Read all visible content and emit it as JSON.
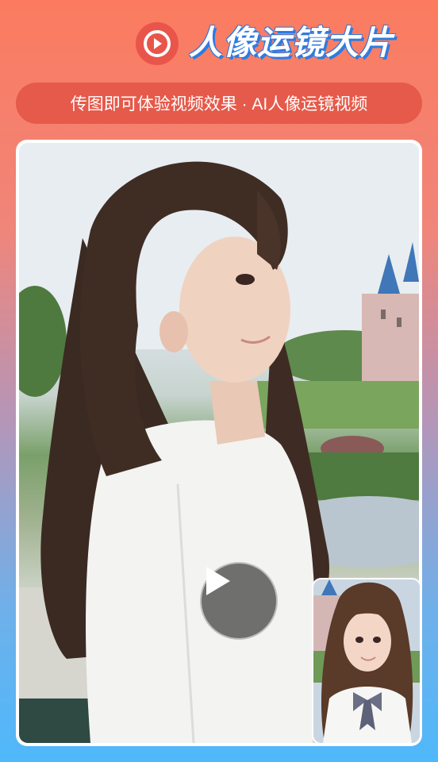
{
  "header": {
    "title": "人像运镜大片",
    "icon": "play-circle-icon",
    "badge_color": "#e9554a"
  },
  "subtitle": {
    "text": "传图即可体验视频效果 · AI人像运镜视频"
  },
  "preview": {
    "main_image": "portrait-photo",
    "play_icon": "play-icon",
    "thumbnail_image": "reference-portrait-thumbnail"
  },
  "colors": {
    "pill": "#e55a4a",
    "title_outline": "#2f7be0",
    "bg_top": "#fb7b5f",
    "bg_bottom": "#4fb8fb"
  }
}
